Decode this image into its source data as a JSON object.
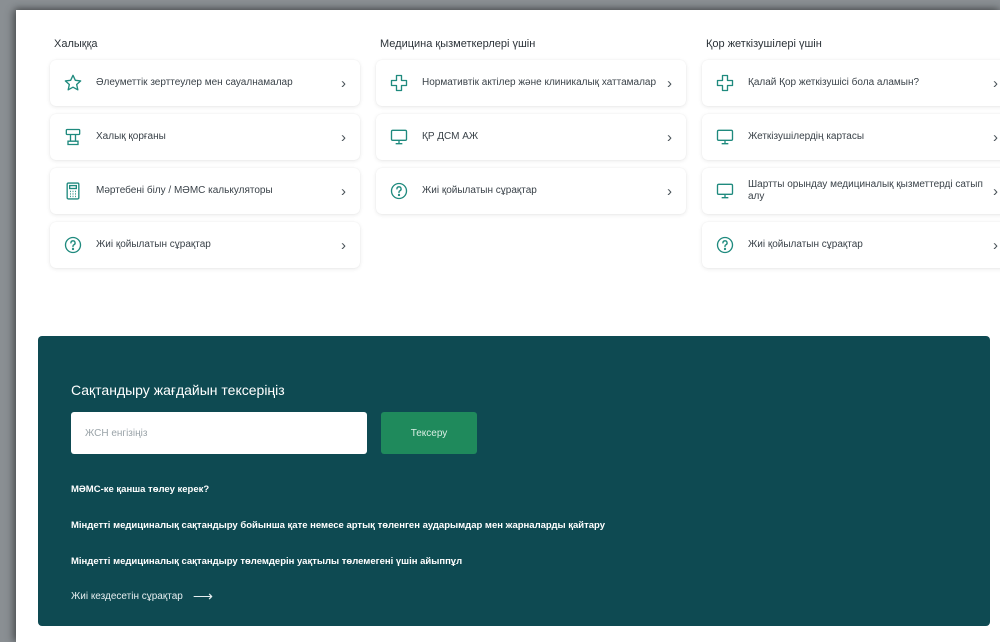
{
  "columns": [
    {
      "title": "Халыққа",
      "items": [
        {
          "label": "Әлеуметтік зерттеулер мен сауалнамалар",
          "icon": "star-icon"
        },
        {
          "label": "Халық қорғаны",
          "icon": "document-stamp-icon"
        },
        {
          "label": "Мәртебені білу / МӘМС калькуляторы",
          "icon": "calculator-icon"
        },
        {
          "label": "Жиі қойылатын сұрақтар",
          "icon": "question-icon"
        }
      ]
    },
    {
      "title": "Медицина қызметкерлері үшін",
      "items": [
        {
          "label": "Нормативтік актілер және клиникалық хаттамалар",
          "icon": "medical-cross-icon"
        },
        {
          "label": "ҚР ДСМ АЖ",
          "icon": "monitor-icon"
        },
        {
          "label": "Жиі қойылатын сұрақтар",
          "icon": "question-icon"
        }
      ]
    },
    {
      "title": "Қор жеткізушілері үшін",
      "items": [
        {
          "label": "Қалай Қор жеткізушісі бола аламын?",
          "icon": "medical-cross-icon"
        },
        {
          "label": "Жеткізушілердің картасы",
          "icon": "monitor-icon"
        },
        {
          "label": "Шартты орындау медициналық қызметтерді сатып алу",
          "icon": "monitor-icon"
        },
        {
          "label": "Жиі қойылатын сұрақтар",
          "icon": "question-icon"
        }
      ]
    }
  ],
  "insurance": {
    "title": "Сақтандыру жағдайын тексеріңіз",
    "input_placeholder": "ЖСН енгізіңіз",
    "button_label": "Тексеру",
    "links": [
      "МӘМС-ке қанша төлеу керек?",
      "Міндетті медициналық сақтандыру бойынша қате немесе артық төленген аударымдар мен жарналарды қайтару",
      "Міндетті медициналық сақтандыру төлемдерін уақтылы төлемегені үшін айыппұл"
    ],
    "faq_link": "Жиі кездесетін сұрақтар",
    "faq_arrow": "⟶"
  },
  "colors": {
    "icon": "#1f8a7e",
    "banner": "#0e4a52",
    "button": "#1f8a5c"
  }
}
